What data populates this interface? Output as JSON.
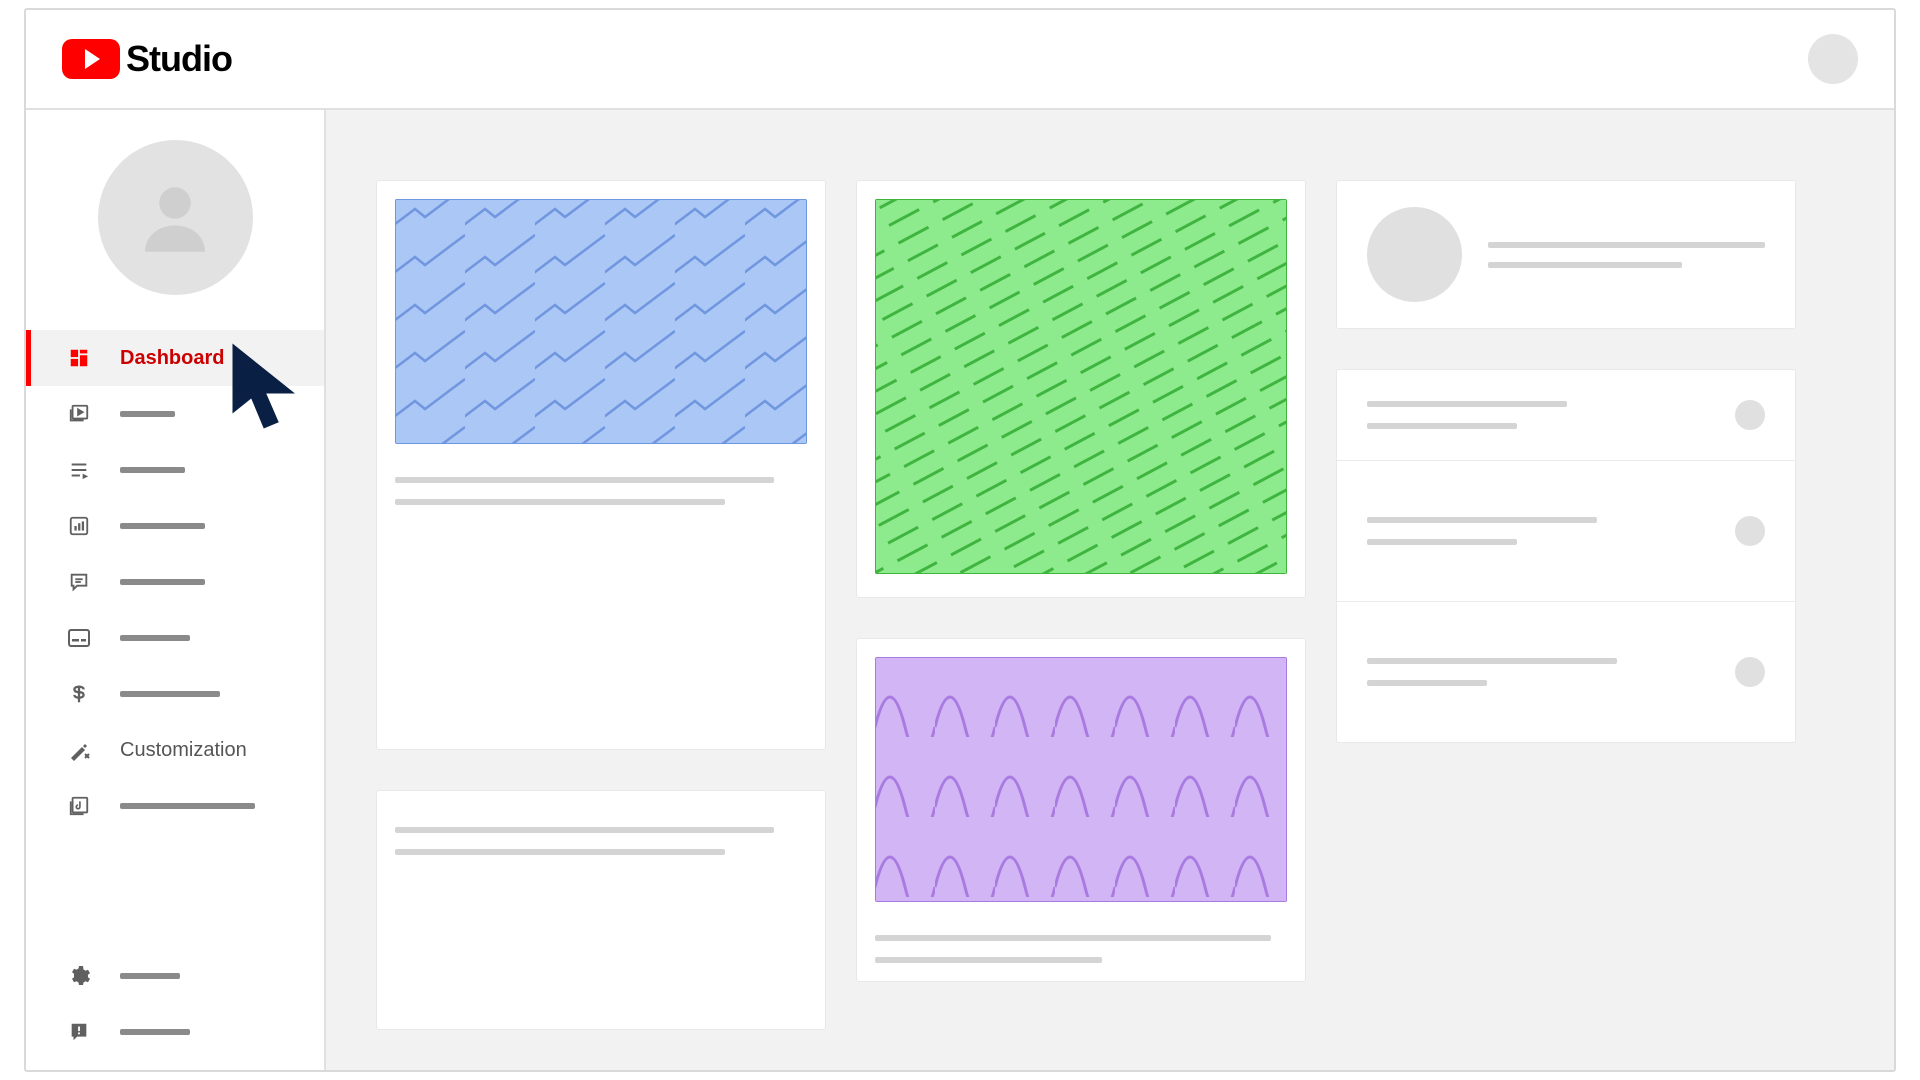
{
  "header": {
    "app_name": "Studio"
  },
  "sidebar": {
    "items": [
      {
        "id": "dashboard",
        "label": "Dashboard",
        "active": true,
        "showText": true
      },
      {
        "id": "content",
        "label": "",
        "active": false
      },
      {
        "id": "playlists",
        "label": "",
        "active": false
      },
      {
        "id": "analytics",
        "label": "",
        "active": false
      },
      {
        "id": "comments",
        "label": "",
        "active": false
      },
      {
        "id": "subtitles",
        "label": "",
        "active": false
      },
      {
        "id": "monetization",
        "label": "",
        "active": false
      },
      {
        "id": "customization",
        "label": "Customization",
        "active": false,
        "showText": true
      },
      {
        "id": "audio",
        "label": "",
        "active": false
      }
    ],
    "bottom_items": [
      {
        "id": "settings",
        "label": ""
      },
      {
        "id": "feedback",
        "label": ""
      }
    ]
  },
  "colors": {
    "brand_red": "#ff0000",
    "thumb_blue": "#aac7f5",
    "thumb_blue_stroke": "#7096e0",
    "thumb_green": "#8dea8d",
    "thumb_green_stroke": "#3fb53f",
    "thumb_purple": "#d2b5f5",
    "thumb_purple_stroke": "#a97be0"
  }
}
